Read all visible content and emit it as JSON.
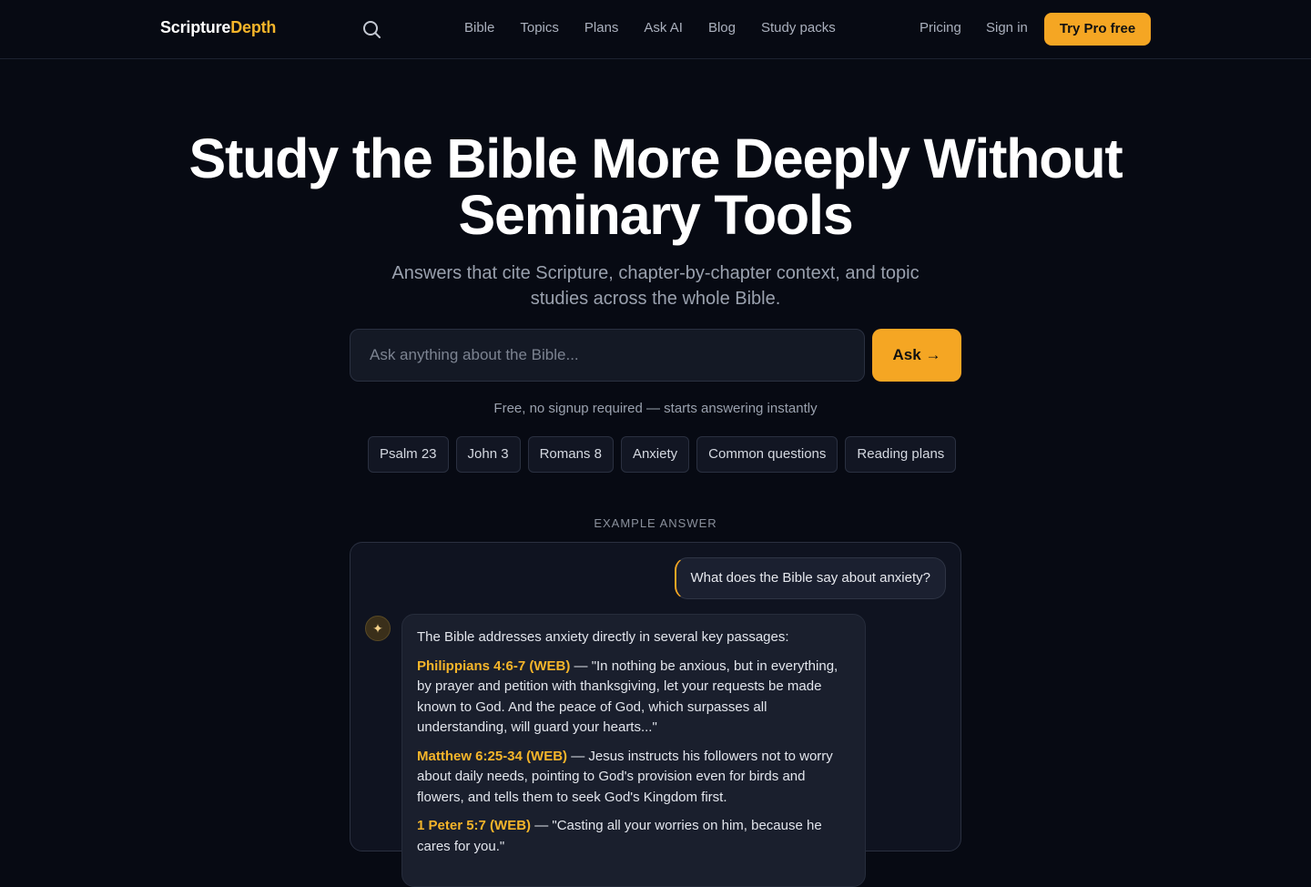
{
  "nav": {
    "logo_part1": "Scripture",
    "logo_part2": "Depth",
    "links": [
      "Bible",
      "Topics",
      "Plans",
      "Ask AI",
      "Blog",
      "Study packs"
    ],
    "pricing": "Pricing",
    "signin": "Sign in",
    "try_pro": "Try Pro free"
  },
  "hero": {
    "title_line1": "Study the Bible More Deeply Without",
    "title_line2": "Seminary Tools",
    "subtitle_line1": "Answers that cite Scripture, chapter-by-chapter context, and topic",
    "subtitle_line2": "studies across the whole Bible.",
    "input_placeholder": "Ask anything about the Bible...",
    "ask_button": "Ask →",
    "free_note": "Free, no signup required — starts answering instantly",
    "chips": [
      "Psalm 23",
      "John 3",
      "Romans 8",
      "Anxiety",
      "Common questions",
      "Reading plans"
    ]
  },
  "example": {
    "label": "EXAMPLE ANSWER",
    "question": "What does the Bible say about anxiety?",
    "avatar_glyph": "✦",
    "intro": "The Bible addresses anxiety directly in several key passages:",
    "items": [
      {
        "ref": "Philippians 4:6-7 (WEB)",
        "text": " — \"In nothing be anxious, but in everything, by prayer and petition with thanksgiving, let your requests be made known to God. And the peace of God, which surpasses all understanding, will guard your hearts...\""
      },
      {
        "ref": "Matthew 6:25-34 (WEB)",
        "text": " — Jesus instructs his followers not to worry about daily needs, pointing to God's provision even for birds and flowers, and tells them to seek God's Kingdom first."
      },
      {
        "ref": "1 Peter 5:7 (WEB)",
        "text": " — \"Casting all your worries on him, because he cares for you.\""
      }
    ]
  },
  "colors": {
    "background": "#070a13",
    "accent": "#f5a623",
    "brand_highlight": "#f5b52a"
  }
}
